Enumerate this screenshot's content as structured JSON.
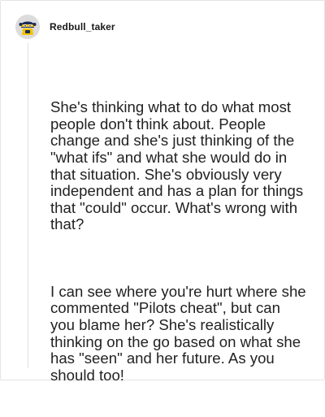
{
  "comment": {
    "author": {
      "username": "Redbull_taker",
      "avatar_icon": "helmet-mascot-avatar-icon"
    },
    "paragraphs": [
      "She's thinking what to do what most people don't think about. People change and she's just thinking of the \"what ifs\" and what she would do in that situation. She's obviously very independent and has a plan for things that \"could\" occur. What's wrong with that?",
      "I can see where you're hurt where she commented \"Pilots cheat\", but can you blame her? She's realistically thinking on the go based on what she has \"seen\" and her future. As you should too!"
    ]
  },
  "colors": {
    "text": "#222222",
    "border": "#e4e4e4",
    "thread_line": "#e1e1e1",
    "avatar_bg": "#dcdcdc",
    "avatar_yellow": "#f2c400",
    "avatar_navy": "#1d2b5a"
  }
}
